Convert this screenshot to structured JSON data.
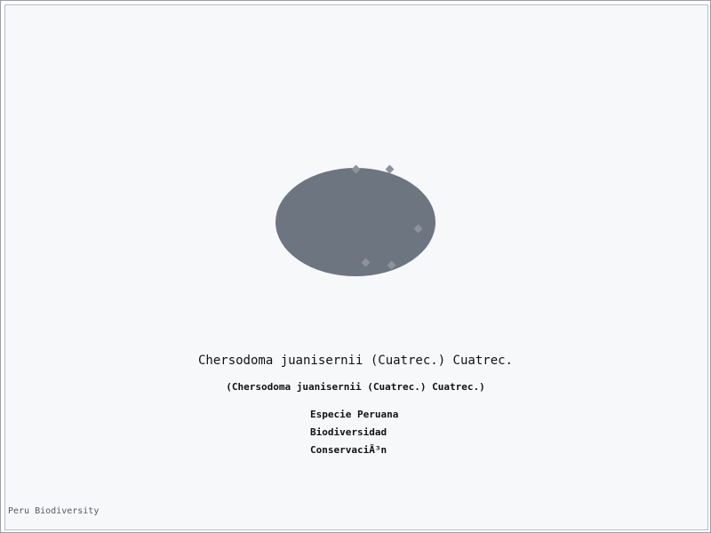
{
  "colors": {
    "background": "#f7f8fa",
    "blob": "#6d7580",
    "dots": "#8d939b",
    "text": "#111111",
    "footer": "#555a61"
  },
  "species": {
    "title": "Chersodoma juanisernii (Cuatrec.) Cuatrec.",
    "subtitle": "(Chersodoma juanisernii (Cuatrec.) Cuatrec.)"
  },
  "tags": [
    "Especie Peruana",
    "Biodiversidad",
    "ConservaciÃ³n"
  ],
  "footer": {
    "text": "Peru Biodiversity"
  }
}
